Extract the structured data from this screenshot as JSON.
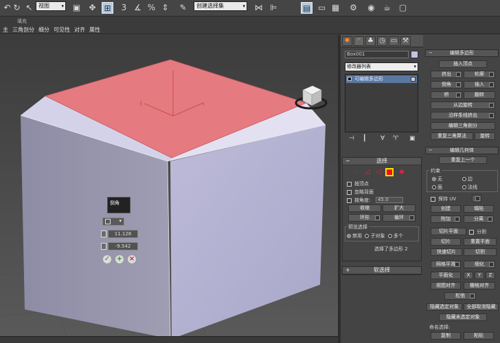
{
  "toolbar": {
    "view_dropdown": "视图",
    "snap_labels": [
      "3",
      "%"
    ],
    "selection_set": "创建选择集"
  },
  "ribbon": {
    "title": "填充",
    "tabs": [
      "主",
      "三角剖分",
      "细分",
      "可见性",
      "对齐",
      "属性"
    ]
  },
  "caddy": {
    "title": "倒角",
    "height_value": "11.128",
    "outline_value": "-9.542",
    "buttons": [
      "✓",
      "+",
      "×"
    ]
  },
  "command_panel": {
    "object_name": "Box001",
    "modifier_list": "修改器列表",
    "stack_item": "可编辑多边形",
    "selection": {
      "title": "选择",
      "by_vertex": "按顶点",
      "ignore_backfacing": "忽略背面",
      "by_angle": "按角度:",
      "angle_value": "45.0",
      "shrink": "收缩",
      "grow": "扩大",
      "ring": "环形",
      "loop": "循环",
      "preview_title": "预览选择",
      "preview_options": [
        "禁用",
        "子对象",
        "多个"
      ],
      "status": "选择了多边形 2"
    },
    "soft_selection": "软选择"
  },
  "right_panel": {
    "edit_poly_title": "编辑多边形",
    "insert_vertex": "插入顶点",
    "extrude": "挤出",
    "outline": "轮廓",
    "bevel": "倒角",
    "inset": "插入",
    "bridge": "桥",
    "flip": "翻转",
    "hinge_from_edge": "从边旋转",
    "extrude_along_spline": "沿样条线挤出",
    "edit_triangulation": "编辑三角剖分",
    "retriangulate": "重复三角算法",
    "turn": "旋转",
    "edit_geometry_title": "编辑几何体",
    "repeat_last": "重复上一个",
    "constraints_label": "约束",
    "constraints": [
      "无",
      "边",
      "面",
      "法线"
    ],
    "preserve_uvs": "保持 UV",
    "create": "创建",
    "collapse": "塌陷",
    "attach": "附加",
    "detach": "分离",
    "slice_plane": "切片平面",
    "split": "分割",
    "slice": "切片",
    "reset_plane": "重置平面",
    "quickslice": "快速切片",
    "cut": "切割",
    "meshsmooth": "网格平滑",
    "tessellate": "细化",
    "make_planar": "平面化",
    "x": "X",
    "y": "Y",
    "z": "Z",
    "view_align": "视图对齐",
    "grid_align": "栅格对齐",
    "relax": "松弛",
    "hide_selected": "隐藏选定对象",
    "unhide_all": "全部取消隐藏",
    "hide_unselected": "隐藏未选定对象",
    "named_selections": "命名选择:",
    "copy": "复制",
    "paste": "粘贴"
  },
  "colors": {
    "top_face": "#e57a80",
    "side_face_light": "#b8b6d4",
    "side_face_mid": "#cfcde4",
    "side_face_dark": "#5e5e73"
  }
}
